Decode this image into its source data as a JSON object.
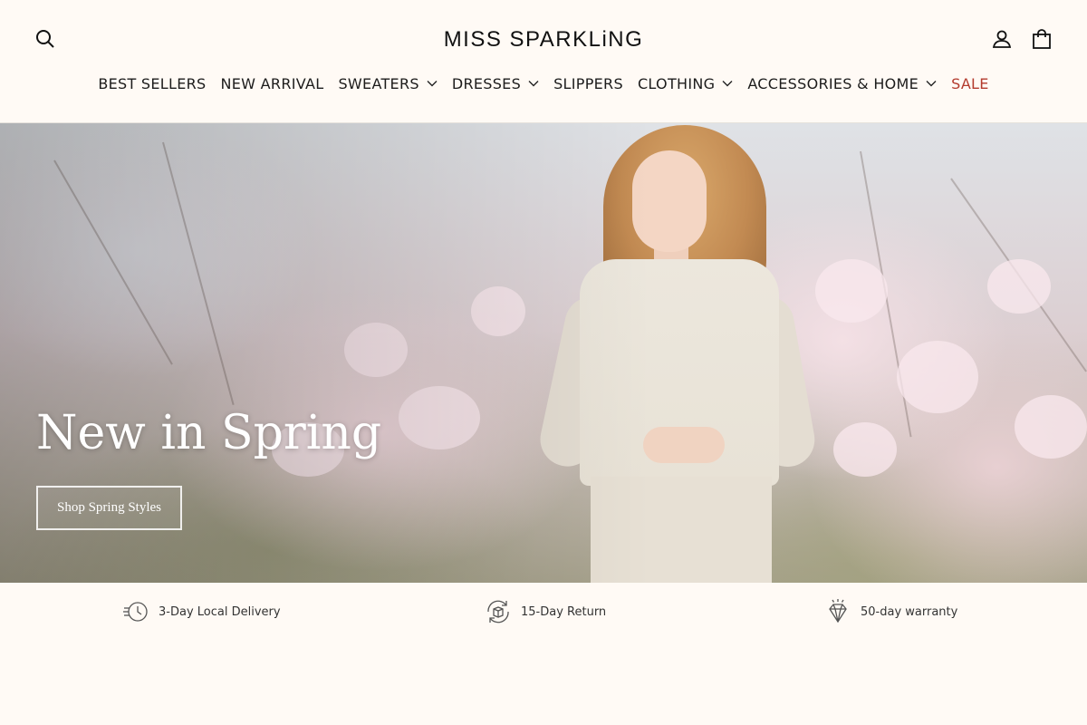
{
  "header": {
    "logo_text": "MISS SPARKLiNG",
    "icons": {
      "search": "search-icon",
      "account": "account-icon",
      "cart": "cart-icon"
    }
  },
  "nav": {
    "items": [
      {
        "label": "BEST SELLERS",
        "has_dropdown": false
      },
      {
        "label": "NEW ARRIVAL",
        "has_dropdown": false
      },
      {
        "label": "SWEATERS",
        "has_dropdown": true
      },
      {
        "label": "DRESSES",
        "has_dropdown": true
      },
      {
        "label": "SLIPPERS",
        "has_dropdown": false
      },
      {
        "label": "CLOTHING",
        "has_dropdown": true
      },
      {
        "label": "ACCESSORIES & HOME",
        "has_dropdown": true
      },
      {
        "label": "SALE",
        "has_dropdown": false
      }
    ],
    "sale_color": "#b33b2e"
  },
  "hero": {
    "title": "New in Spring",
    "button_label": "Shop Spring Styles"
  },
  "features": [
    {
      "icon": "fast-delivery-icon",
      "label": "3-Day Local Delivery"
    },
    {
      "icon": "return-box-icon",
      "label": "15-Day Return"
    },
    {
      "icon": "diamond-icon",
      "label": "50-day warranty"
    }
  ],
  "colors": {
    "background": "#fffaf5",
    "text": "#1c1c1c",
    "accent_sale": "#b33b2e"
  }
}
